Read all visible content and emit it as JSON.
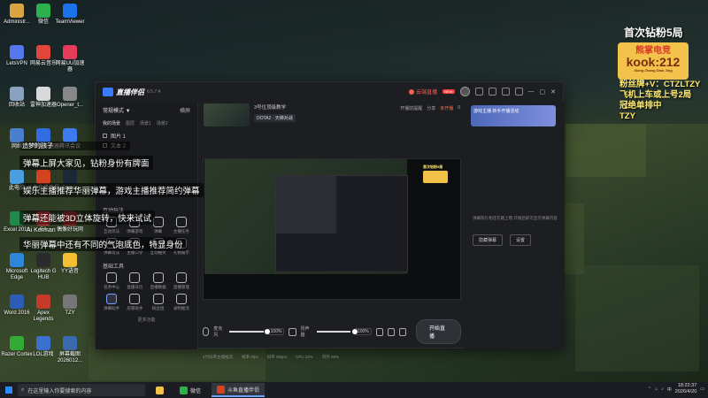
{
  "desktop": {
    "icons_col1": [
      {
        "label": "Administr...",
        "color": "#d9a441"
      },
      {
        "label": "LetsVPN",
        "color": "#5577ee"
      },
      {
        "label": "回收站",
        "color": "#8aa2c0"
      },
      {
        "label": "网络",
        "color": "#4a7fd0"
      },
      {
        "label": "此电脑",
        "color": "#4a9fe0"
      },
      {
        "label": "Excel 2016",
        "color": "#1f8a4c"
      },
      {
        "label": "Microsoft Edge",
        "color": "#2e86d8"
      },
      {
        "label": "Word 2016",
        "color": "#2a5cb8"
      },
      {
        "label": "Razer Cortex",
        "color": "#33aa33"
      }
    ],
    "icons_col2": [
      {
        "label": "微信",
        "color": "#2bb24c"
      },
      {
        "label": "网易云音乐",
        "color": "#e2453c"
      },
      {
        "label": "雷神加速器",
        "color": "#d9d9d9"
      },
      {
        "label": "小黑盒加速器",
        "color": "#2f6de0"
      },
      {
        "label": "斗鱼直播伴侣",
        "color": "#d4431f"
      },
      {
        "label": "EA",
        "color": "#d83b3b"
      },
      {
        "label": "Logitech G HUB",
        "color": "#2b2b2b"
      },
      {
        "label": "Apex Legends",
        "color": "#c43b2b"
      },
      {
        "label": "LOL游戏",
        "color": "#3b6fd0"
      }
    ],
    "icons_col3": [
      {
        "label": "TeamViewer",
        "color": "#1a73e8"
      },
      {
        "label": "网易UU加速器",
        "color": "#e63b5a"
      },
      {
        "label": "Opener_t...",
        "color": "#888888"
      },
      {
        "label": "腾讯会议",
        "color": "#3d7bf0"
      },
      {
        "label": "Steam",
        "color": "#1b2838"
      },
      {
        "label": "偶像好玩网",
        "color": "#b03030"
      },
      {
        "label": "YY语音",
        "color": "#f3c033"
      },
      {
        "label": "TZY",
        "color": "#777777"
      },
      {
        "label": "屏幕截图 2026012...",
        "color": "#3a6ab0"
      }
    ]
  },
  "app": {
    "name": "直播伴侣",
    "version": "6.5.7.4",
    "live_label": "云端直播",
    "badge": "NEW",
    "window_icons": [
      "headset-icon",
      "chat-icon",
      "gift-icon",
      "settings-icon",
      "minimize-icon",
      "maximize-icon",
      "close-icon"
    ],
    "mode": "常规模式 ▼",
    "mode_right": "横屏",
    "source_tabs": [
      "我的场景",
      "图层",
      "场景1",
      "场景2"
    ],
    "sources": [
      {
        "label": "图片 1"
      },
      {
        "label": "文本 2"
      }
    ],
    "interactive_title": "互动玩法",
    "interactive_tools": [
      "互动玩法",
      "弹幕游戏",
      "弹幕",
      "主播任务",
      "弹幕玩法",
      "主播口令",
      "互动抽奖",
      "礼物展示"
    ],
    "basic_title": "基础工具",
    "basic_tools": [
      "任务中心",
      "直播日历",
      "直播数据",
      "直播管理",
      "弹幕助手",
      "房管助手",
      "粉丝团",
      "录制推流"
    ],
    "more_label": "更多功能",
    "stream": {
      "title": "3号位顶级教学",
      "category": "DOTA2 · 天梯对战",
      "actions": [
        "开播前提醒",
        "分享",
        "未开播",
        "0"
      ]
    },
    "mic_label": "麦克风",
    "mic_volume": "100%",
    "speaker_label": "扬声器",
    "speaker_volume": "100%",
    "tool_labels": [
      "画质",
      "定时",
      "设置"
    ],
    "start_button": "开始直播",
    "status": [
      "4代码率主播推流",
      "帧率 0fps",
      "码率 0kbps",
      "CPU 22%",
      "内存 60%"
    ],
    "chat_empty": "弹幕和礼物还在路上哦 开播后即可显示弹幕内容",
    "chat_buttons": [
      "隐藏弹幕",
      "设置"
    ],
    "ad_text": "游戏主播 新手开播活动"
  },
  "overlay": {
    "danmaku_bar": "追梦的孩子",
    "danmaku": [
      "弹幕上屏大家见，钻粉身份有牌面",
      "娱乐主播推荐华丽弹幕，游戏主播推荐简约弹幕",
      "弹幕还能被3D立体旋转，快来试试",
      "华丽弹幕中还有不同的气泡底色，特显身份"
    ],
    "small_labels": [
      "Ai Kerman"
    ],
    "right_title": "首次钻粉5局",
    "kook_top": "熊掌电竞",
    "kook_big": "kook:212",
    "kook_small": "Xiong Zhang Dian Jing",
    "right_lines": [
      "粉丝牌+V：CTZLTZY",
      "飞机上车或上号2局",
      "冠绝单排中",
      "TZY"
    ]
  },
  "taskbar": {
    "search_placeholder": "在这里输入你要搜索的内容",
    "apps": [
      {
        "label": "",
        "color": "#f0c24a"
      },
      {
        "label": "微信",
        "color": "#2bb24c"
      },
      {
        "label": "斗鱼直播伴侣",
        "color": "#d4431f"
      }
    ],
    "time": "18:22:37",
    "date": "2026/4/20",
    "lang": "中",
    "tray_icons": [
      "chevron-up-icon",
      "network-icon",
      "volume-icon",
      "ime-icon",
      "notification-icon"
    ]
  }
}
